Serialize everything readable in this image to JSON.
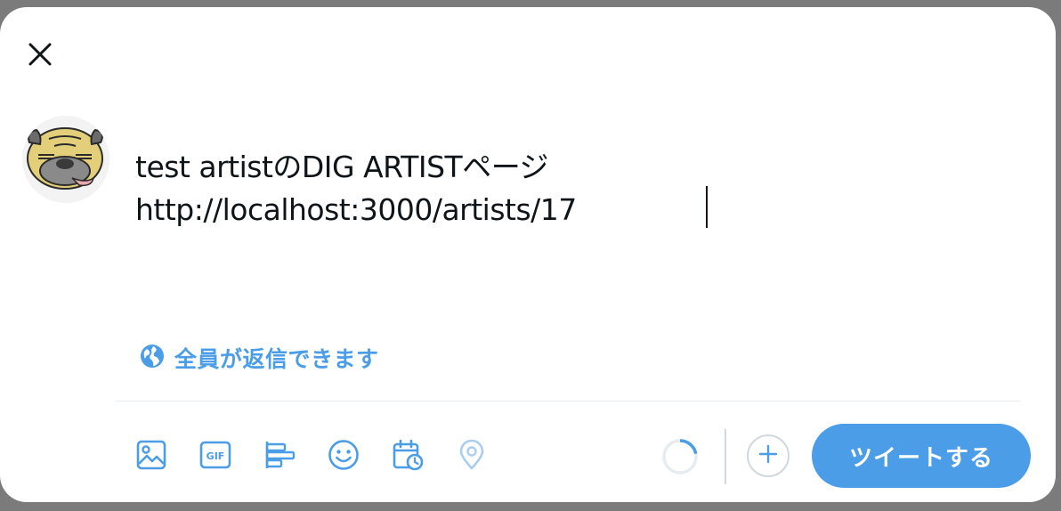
{
  "compose": {
    "line1": "test artistのDIG ARTISTページ",
    "line2": "http://localhost:3000/artists/17"
  },
  "reply_setting": {
    "label": "全員が返信できます",
    "icon": "globe-icon"
  },
  "toolbar": {
    "icons": [
      "image-icon",
      "gif-icon",
      "poll-icon",
      "emoji-icon",
      "schedule-icon",
      "location-icon"
    ]
  },
  "char_counter": {
    "used_fraction": 0.22
  },
  "tweet_button": {
    "label": "ツイートする"
  },
  "colors": {
    "accent": "#4a9de6",
    "text": "#0f1419",
    "disabled_icon": "#a9cdf0"
  }
}
